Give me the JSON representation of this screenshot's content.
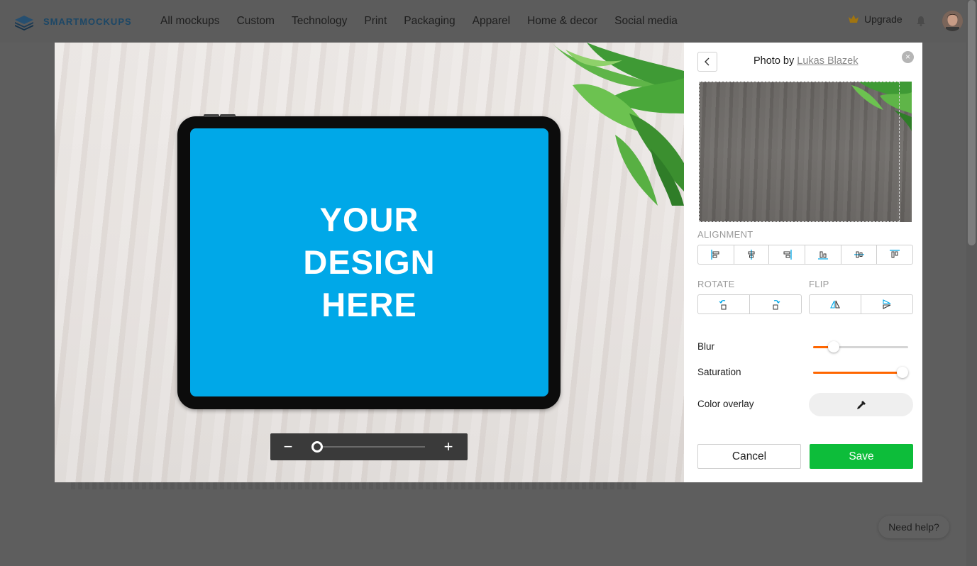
{
  "brand": {
    "name": "SMARTMOCKUPS"
  },
  "nav": {
    "items": [
      "All mockups",
      "Custom",
      "Technology",
      "Print",
      "Packaging",
      "Apparel",
      "Home & decor",
      "Social media"
    ],
    "upgrade_label": "Upgrade"
  },
  "preview": {
    "placeholder_lines": [
      "YOUR",
      "DESIGN",
      "HERE"
    ],
    "zoom_level": 0,
    "zoom_minus": "−",
    "zoom_plus": "+"
  },
  "panel": {
    "photo_by_label": "Photo by",
    "photo_author": "Lukas Blazek",
    "close_symbol": "×",
    "alignment_label": "ALIGNMENT",
    "alignment_buttons": [
      "align-left-icon",
      "align-center-horizontal-icon",
      "align-right-icon",
      "align-bottom-icon",
      "align-center-vertical-icon",
      "align-top-icon"
    ],
    "rotate_label": "ROTATE",
    "rotate_buttons": [
      "rotate-left-icon",
      "rotate-right-icon"
    ],
    "flip_label": "FLIP",
    "flip_buttons": [
      "flip-horizontal-icon",
      "flip-vertical-icon"
    ],
    "blur_label": "Blur",
    "blur_value": 0.22,
    "saturation_label": "Saturation",
    "saturation_value": 0.94,
    "color_overlay_label": "Color overlay",
    "cancel_label": "Cancel",
    "save_label": "Save"
  },
  "help": {
    "label": "Need help?"
  },
  "colors": {
    "accent": "#ff6600",
    "save": "#0dbd3a",
    "screen": "#00a8e8",
    "brand": "#1c4766"
  }
}
